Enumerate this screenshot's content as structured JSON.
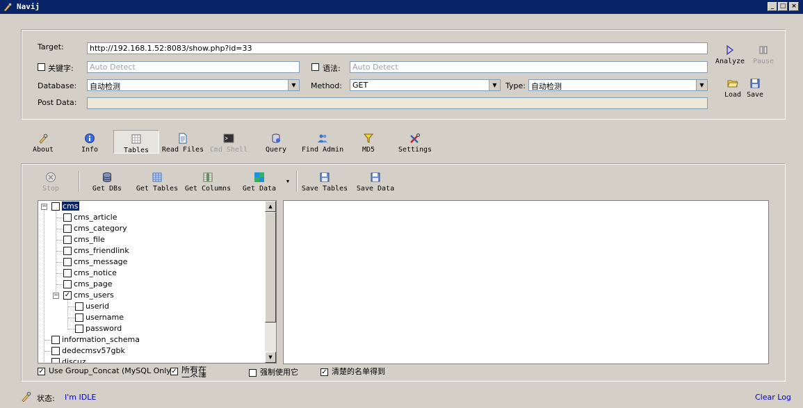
{
  "window": {
    "title": "Navij",
    "icon": "navij-icon"
  },
  "target": {
    "label": "Target:",
    "value": "http://192.168.1.52:8083/show.php?id=33"
  },
  "keyword": {
    "label": "关键字:",
    "placeholder": "Auto Detect",
    "checked": false
  },
  "syntax": {
    "label": "语法:",
    "placeholder": "Auto Detect",
    "checked": false
  },
  "database": {
    "label": "Database:",
    "value": "自动检测"
  },
  "method": {
    "label": "Method:",
    "value": "GET"
  },
  "type": {
    "label": "Type:",
    "value": "自动检测"
  },
  "post": {
    "label": "Post Data:",
    "value": ""
  },
  "side": {
    "analyze": "Analyze",
    "pause": "Pause",
    "load": "Load",
    "save": "Save"
  },
  "nav": [
    {
      "label": "About",
      "icon": "wrench-icon"
    },
    {
      "label": "Info",
      "icon": "info-icon"
    },
    {
      "label": "Tables",
      "icon": "table-icon",
      "selected": true
    },
    {
      "label": "Read Files",
      "icon": "document-icon"
    },
    {
      "label": "Cmd Shell",
      "icon": "terminal-icon",
      "disabled": true
    },
    {
      "label": "Query",
      "icon": "query-icon"
    },
    {
      "label": "Find Admin",
      "icon": "users-icon"
    },
    {
      "label": "MD5",
      "icon": "funnel-icon"
    },
    {
      "label": "Settings",
      "icon": "tools-icon"
    }
  ],
  "toolbar": {
    "stop": "Stop",
    "get_dbs": "Get DBs",
    "get_tables": "Get Tables",
    "get_columns": "Get Columns",
    "get_data": "Get Data",
    "save_tables": "Save Tables",
    "save_data": "Save Data"
  },
  "tree": {
    "root": "cms",
    "tables": [
      {
        "name": "cms_article",
        "checked": false
      },
      {
        "name": "cms_category",
        "checked": false
      },
      {
        "name": "cms_file",
        "checked": false
      },
      {
        "name": "cms_friendlink",
        "checked": false
      },
      {
        "name": "cms_message",
        "checked": false
      },
      {
        "name": "cms_notice",
        "checked": false
      },
      {
        "name": "cms_page",
        "checked": false
      },
      {
        "name": "cms_users",
        "checked": true
      }
    ],
    "columns": [
      "userid",
      "username",
      "password"
    ],
    "other_dbs": [
      "information_schema",
      "dedecmsv57gbk",
      "discuz"
    ]
  },
  "options": {
    "group_concat": {
      "label": "Use Group_Concat (MySQL Only)",
      "checked": true
    },
    "all_in_one": {
      "label": "所有在一个请求",
      "checked": true
    },
    "force": {
      "label": "强制使用它",
      "checked": false
    },
    "clear_list": {
      "label": "清楚的名单得到",
      "checked": true
    }
  },
  "status": {
    "label": "状态:",
    "value": "I'm IDLE",
    "clear_log": "Clear Log"
  },
  "colors": {
    "title_bg": "#0a246a",
    "link": "#0000cc",
    "window_bg": "#d4d0c8"
  }
}
